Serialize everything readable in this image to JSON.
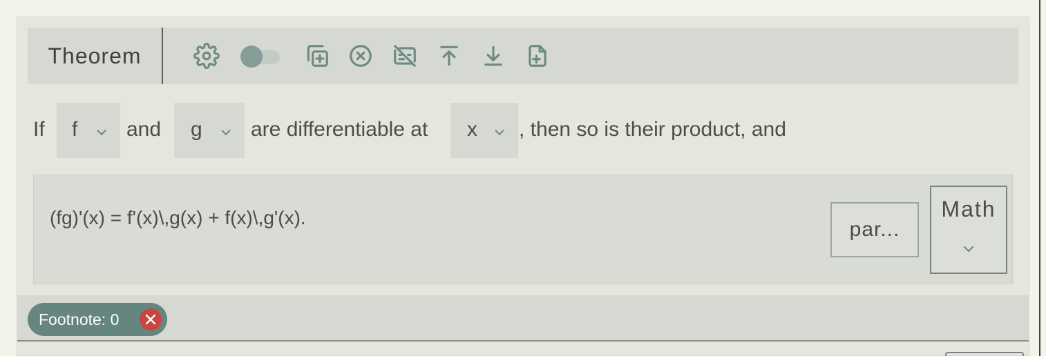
{
  "header": {
    "env_label": "Theorem",
    "icons": [
      "settings-gear-icon",
      "toggle-switch",
      "duplicate-icon",
      "delete-circle-x-icon",
      "hide-caption-icon",
      "move-up-icon",
      "move-down-icon",
      "add-file-icon"
    ],
    "toggle_on": false
  },
  "statement": {
    "t1": "If",
    "sel1": "f",
    "t2": "and",
    "sel2": "g",
    "t3": "are differentiable at",
    "sel3": "x",
    "t4": ", then so is their product, and"
  },
  "math": {
    "formula": "(fg)'(x) = f'(x)\\,g(x) + f(x)\\,g'(x).",
    "par_button": "par...",
    "type_select": "Math"
  },
  "footer": {
    "footnote_label": "Footnote: 0"
  },
  "colors": {
    "accent": "#66857e",
    "icon": "#6d8a83",
    "danger": "#c9453f",
    "card_bg": "#e6e6de",
    "header_bg": "#d6d9d2"
  }
}
